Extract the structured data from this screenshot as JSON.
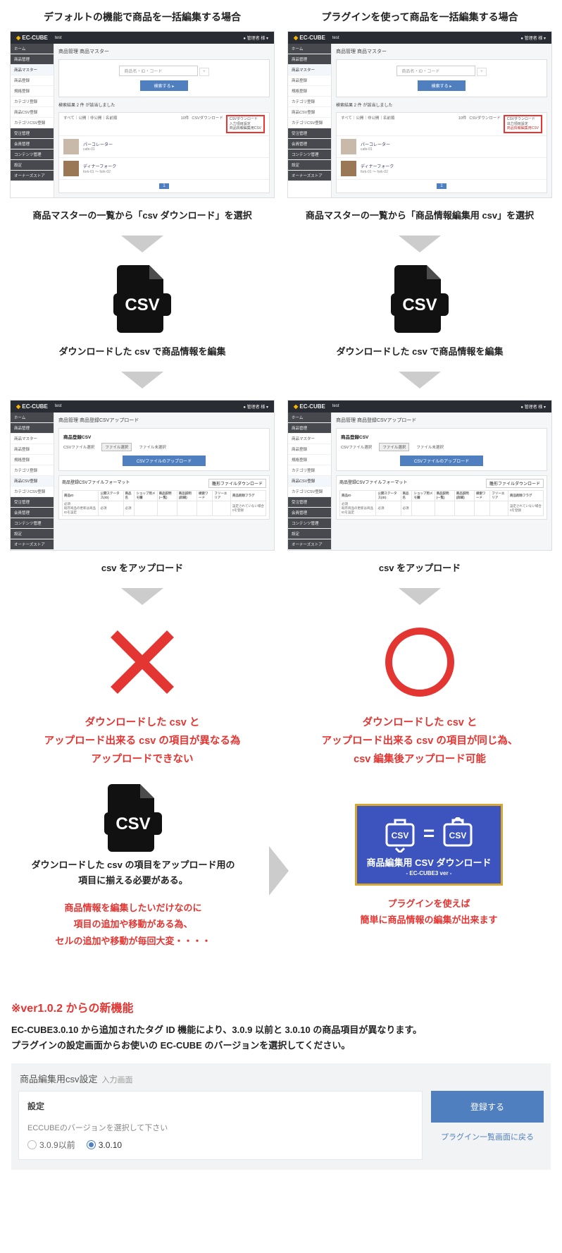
{
  "top": {
    "left_title": "デフォルトの機能で商品を一括編集する場合",
    "right_title": "プラグインを使って商品を一括編集する場合"
  },
  "admin": {
    "brand": "EC-CUBE",
    "site": "test",
    "user": "管理者 様",
    "side_home": "ホーム",
    "side_product": "商品管理",
    "side_items": [
      "商品マスター",
      "商品登録",
      "規格登録",
      "カテゴリ登録",
      "商品CSV登録",
      "カテゴリCSV登録"
    ],
    "side_items_r": [
      "商品マスター",
      "商品登録",
      "規格登録",
      "カテゴリ登録",
      "商品CSV登録",
      "カテゴリCSV登録"
    ],
    "side_others": [
      "受注管理",
      "会員管理",
      "コンテンツ管理",
      "設定",
      "オーナーズストア"
    ],
    "page_title": "商品管理 商品マスター",
    "search_ph": "商品名・ID・コード",
    "search_btn": "検索する",
    "result_text": "検索結果  2 件 が該当しました",
    "sort_text": "すべて｜公開｜非公開｜名前順",
    "page_size": "10件",
    "csv_dl": "CSVダウンロード",
    "csv_menu_left": [
      "CSVダウンロード",
      "入力項目設定",
      "商品情報編集用CSV"
    ],
    "csv_menu_right": [
      "CSVダウンロード",
      "出力項目設定",
      "商品情報編集用CSV"
    ],
    "p1_name": "パーコレーター",
    "p1_code": "cafe-01",
    "p2_name": "ディナーフォーク",
    "p2_code": "fork-01 ～ fork-02",
    "pager": "1"
  },
  "cap": {
    "left1": "商品マスターの一覧から「csv ダウンロード」を選択",
    "right1": "商品マスターの一覧から「商品情報編集用 csv」を選択",
    "edit": "ダウンロードした csv で商品情報を編集",
    "upload": "csv をアップロード"
  },
  "upload": {
    "page_title": "商品管理 商品登録CSVアップロード",
    "card_h": "商品登録CSV",
    "file_label": "CSVファイル選択",
    "file_btn": "ファイル選択",
    "file_none": "ファイル未選択",
    "up_btn": "CSVファイルのアップロード",
    "fmt_h": "商品登録CSVファイルフォーマット",
    "fmt_link": "雛形ファイルダウンロード",
    "th": [
      "商品ID",
      "公開ステータス(ID)",
      "商品名",
      "ショップ用メモ欄",
      "商品説明(一覧)",
      "商品説明(詳細)",
      "検索ワード",
      "フリーエリア",
      "商品削除フラグ"
    ],
    "td": [
      "必須",
      "必須",
      "必須",
      "",
      "",
      "",
      "",
      "",
      "設定されていない場合0を登録"
    ],
    "td_note": "既存商品の更新は商品IDを設定"
  },
  "result": {
    "left_lines": [
      "ダウンロードした csv と",
      "アップロード出来る csv の項目が異なる為",
      "アップロードできない"
    ],
    "right_lines": [
      "ダウンロードした csv と",
      "アップロード出来る csv の項目が同じ為、",
      "csv 編集後アップロード可能"
    ]
  },
  "bottom_left": {
    "black": [
      "ダウンロードした csv の項目をアップロード用の",
      "項目に揃える必要がある。"
    ],
    "red": [
      "商品情報を編集したいだけなのに",
      "項目の追加や移動がある為、",
      "セルの追加や移動が毎回大変・・・・"
    ]
  },
  "bottom_right": {
    "banner_csv": "CSV",
    "banner_t1": "商品編集用 CSV ダウンロード",
    "banner_t2": "- EC-CUBE3 ver -",
    "red": [
      "プラグインを使えば",
      "簡単に商品情報の編集が出来ます"
    ]
  },
  "newf": {
    "h": "※ver1.0.2 からの新機能",
    "p1": "EC-CUBE3.0.10 から追加されたタグ ID 機能により、3.0.9 以前と 3.0.10 の商品項目が異なります。",
    "p2": "プラグインの設定画面からお使いの EC-CUBE のバージョンを選択してください。",
    "set_title": "商品編集用csv設定",
    "set_sub": "入力画面",
    "set_h": "設定",
    "set_note": "ECCUBEのバージョンを選択して下さい",
    "r1": "3.0.9以前",
    "r2": "3.0.10",
    "btn": "登録する",
    "back": "プラグイン一覧画面に戻る"
  }
}
